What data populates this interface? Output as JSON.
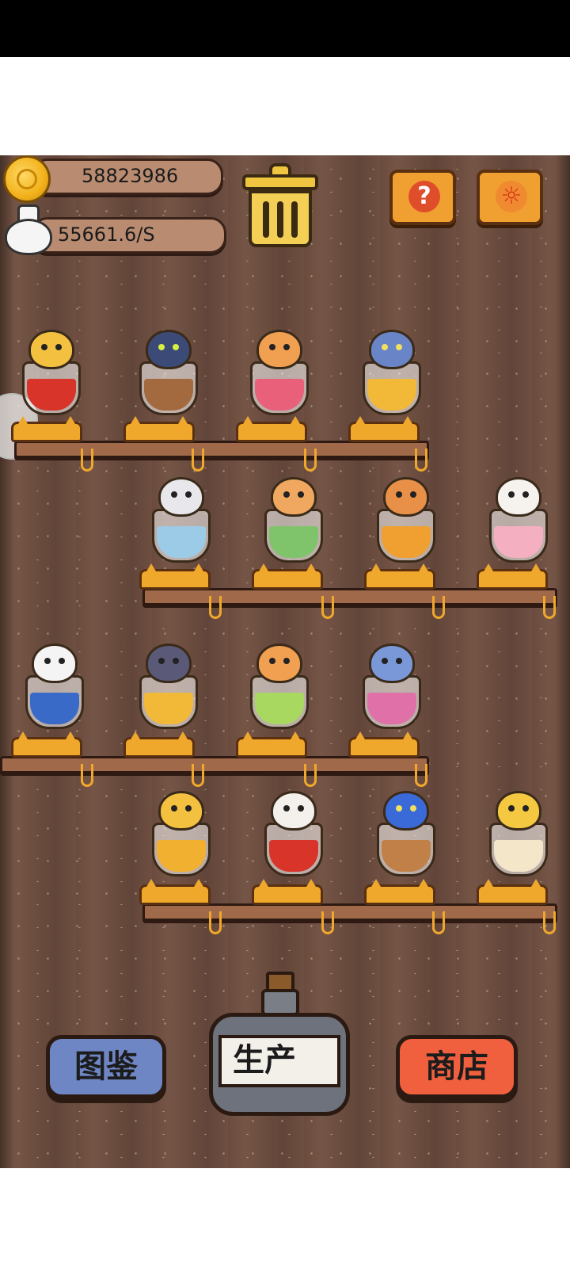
{
  "resources": {
    "coins": "58823986",
    "income_rate": "55661.6/S"
  },
  "buttons": {
    "help_glyph": "?",
    "settings_glyph": "☼",
    "catalog_label": "图鉴",
    "produce_label": "生产",
    "shop_label": "商店"
  },
  "colors": {
    "catalog_button": "#6f86c4",
    "shop_button": "#f0603e",
    "corner_button": "#f0a030",
    "shelf_peg": "#f0a82c"
  },
  "icons": [
    "coin-icon",
    "money-bag-icon",
    "trash-can-icon",
    "help-icon",
    "settings-gear-icon",
    "potion-bottle-icon"
  ]
}
